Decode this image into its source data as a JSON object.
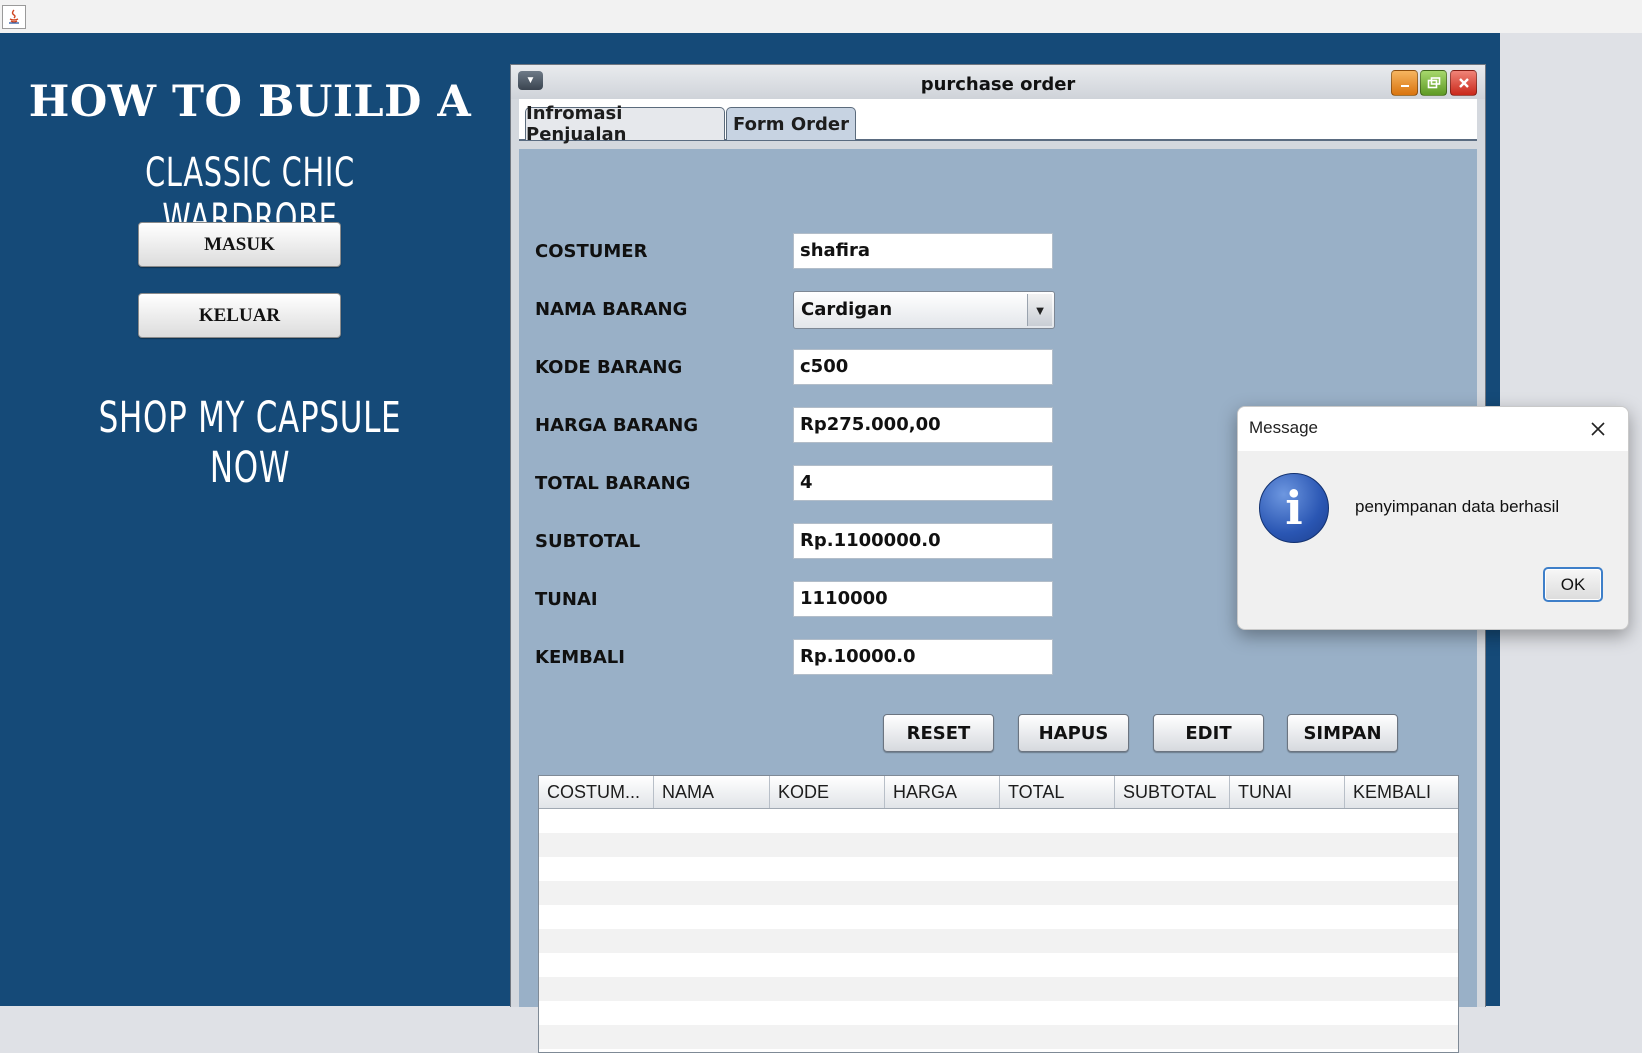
{
  "app": {
    "title": "purchase order",
    "window_buttons": [
      "minimize-icon",
      "maximize-icon",
      "close-icon"
    ]
  },
  "left_panel": {
    "line1": "HOW TO BUILD A",
    "line2": "CLASSIC CHIC WARDROBE",
    "masuk_label": "MASUK",
    "keluar_label": "KELUAR",
    "line3": "SHOP MY CAPSULE NOW"
  },
  "tabs": [
    {
      "label": "Infromasi Penjualan",
      "active": false
    },
    {
      "label": "Form Order",
      "active": true
    }
  ],
  "form": {
    "costumer": {
      "label": "COSTUMER",
      "value": "shafira"
    },
    "nama_barang": {
      "label": "NAMA BARANG",
      "value": "Cardigan"
    },
    "kode_barang": {
      "label": "KODE BARANG",
      "value": "c500"
    },
    "harga_barang": {
      "label": "HARGA BARANG",
      "value": "Rp275.000,00"
    },
    "total_barang": {
      "label": "TOTAL BARANG",
      "value": "4"
    },
    "subtotal": {
      "label": "SUBTOTAL",
      "value": "Rp.1100000.0"
    },
    "tunai": {
      "label": "TUNAI",
      "value": "1110000"
    },
    "kembali": {
      "label": "KEMBALI",
      "value": "Rp.10000.0"
    }
  },
  "actions": {
    "reset": "RESET",
    "hapus": "HAPUS",
    "edit": "EDIT",
    "simpan": "SIMPAN"
  },
  "table": {
    "columns": [
      "COSTUM...",
      "NAMA",
      "KODE",
      "HARGA",
      "TOTAL",
      "SUBTOTAL",
      "TUNAI",
      "KEMBALI"
    ],
    "rows": []
  },
  "dialog": {
    "title": "Message",
    "message": "penyimpanan data berhasil",
    "ok_label": "OK",
    "icon": "info-icon"
  },
  "colors": {
    "desktop_bg": "#154a78",
    "panel_bg": "#99b0c7",
    "dialog_accent": "#3e7fc9"
  }
}
